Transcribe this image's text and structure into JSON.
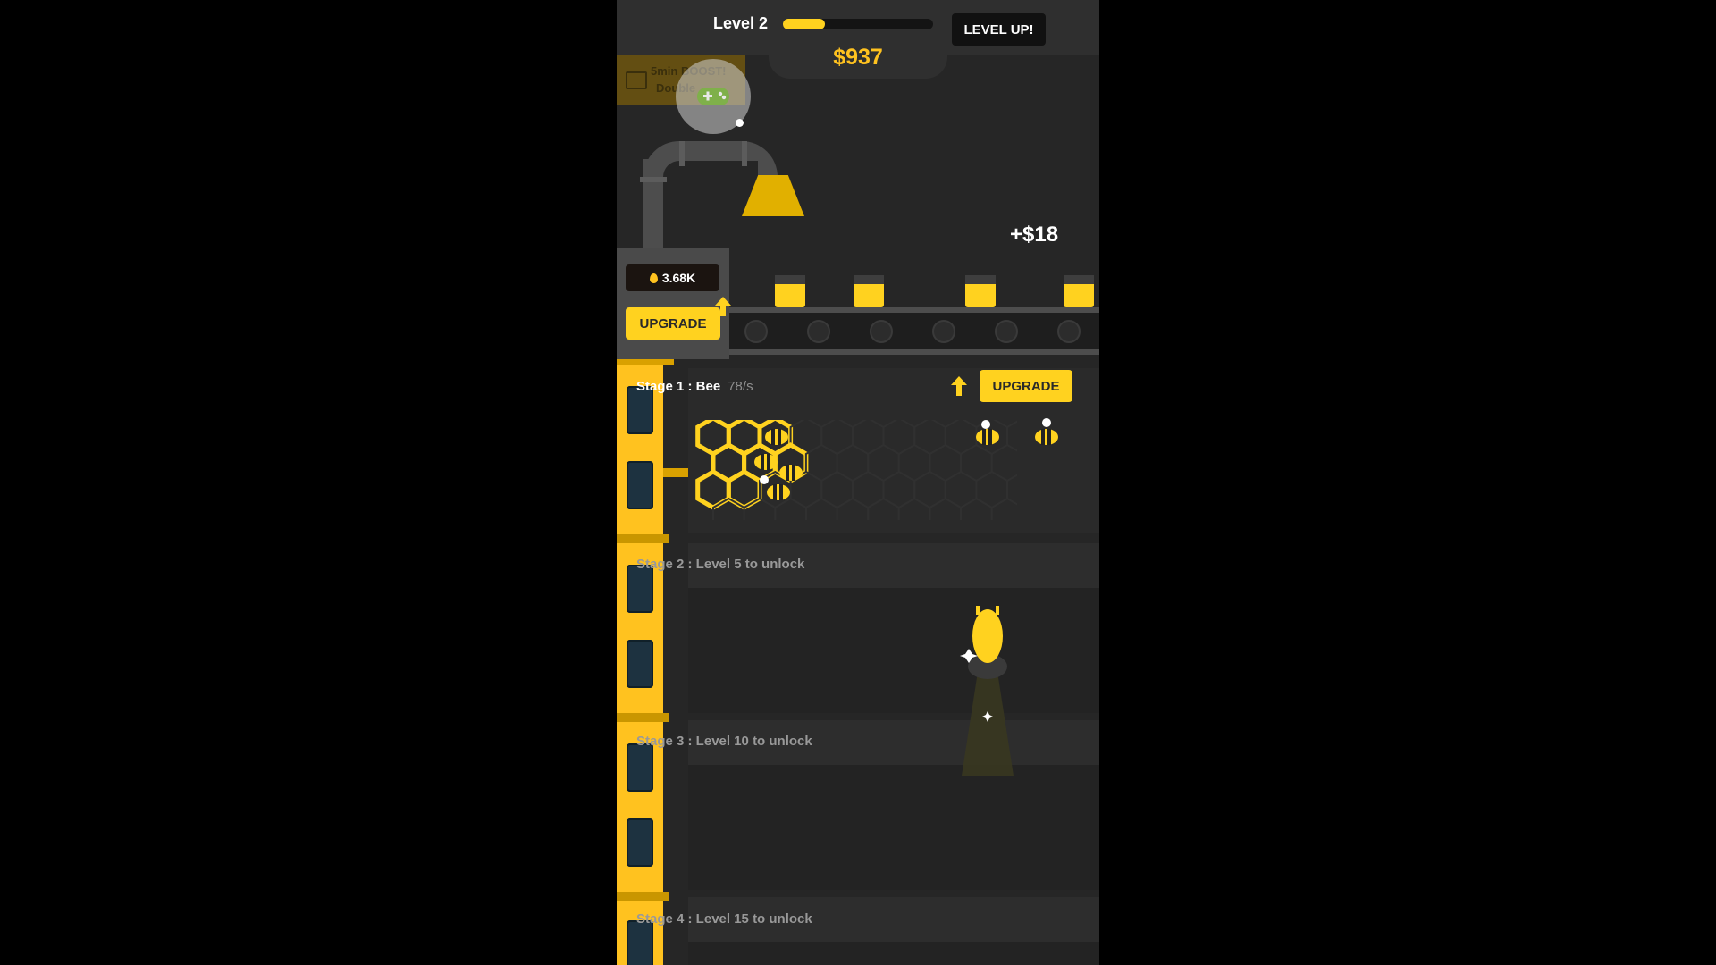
{
  "hud": {
    "level_label": "Level 2",
    "level_progress": 0.28,
    "level_up_label": "LEVEL UP!",
    "money": "$937"
  },
  "boost": {
    "line1": "5min BOOST!",
    "line2": "Double"
  },
  "machine": {
    "honey_amount": "3.68K",
    "upgrade_label": "UPGRADE"
  },
  "floating_income": "+$18",
  "stages": [
    {
      "title": "Stage 1 : Bee",
      "rate": "78/s",
      "upgrade_label": "UPGRADE"
    },
    {
      "title": "Stage 2 : Level 5 to unlock"
    },
    {
      "title": "Stage 3 : Level 10 to unlock"
    },
    {
      "title": "Stage 4 : Level 15 to unlock"
    }
  ],
  "colors": {
    "accent": "#ffd21f",
    "money": "#ffc21f",
    "panel": "#2d2d2d",
    "background": "#262626"
  }
}
